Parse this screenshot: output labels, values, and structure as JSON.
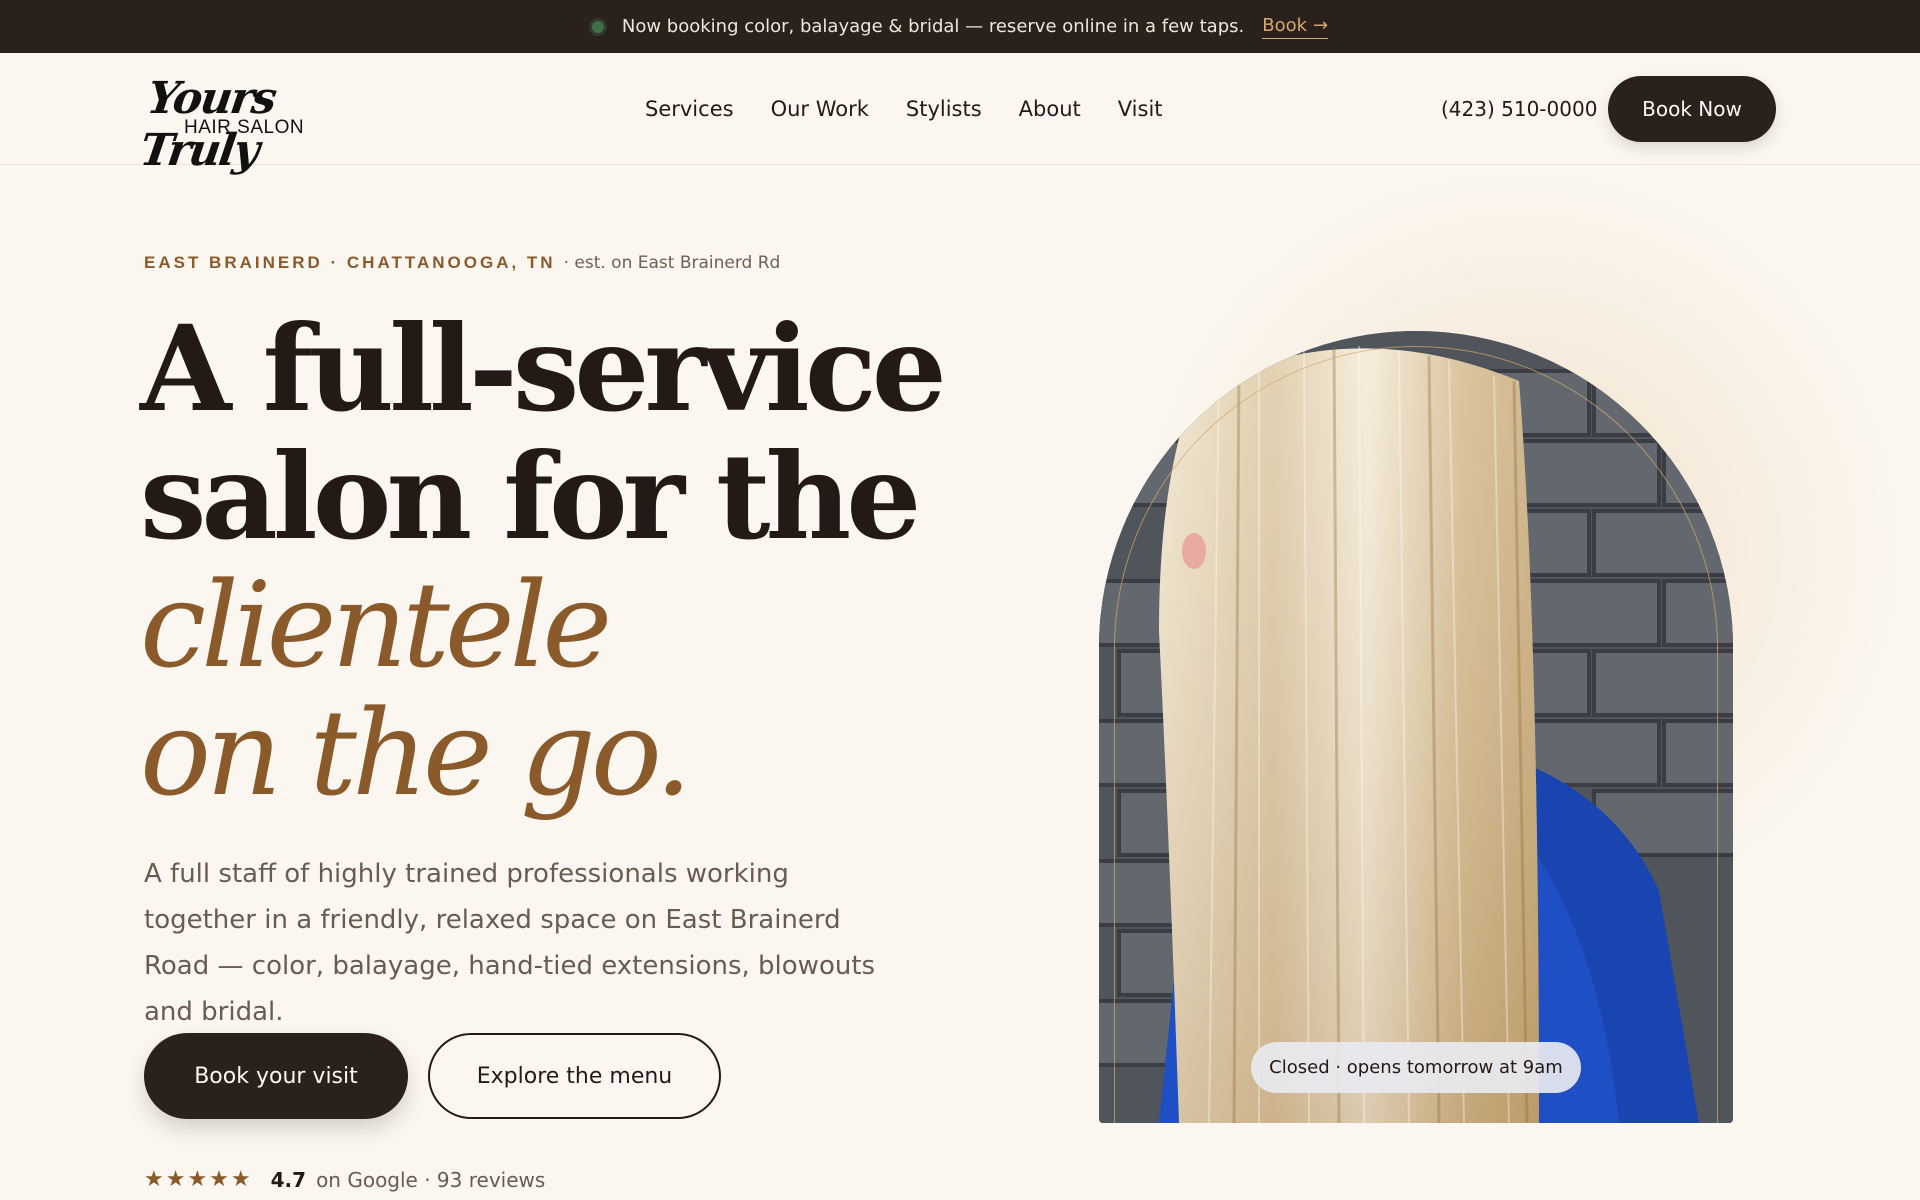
{
  "announcement": {
    "message": "Now booking color, balayage & bridal — reserve online in a few taps.",
    "link_label": "Book",
    "link_arrow": "→"
  },
  "header": {
    "logo_script": "Yours Truly",
    "logo_sub": "HAIR SALON",
    "nav": [
      "Services",
      "Our Work",
      "Stylists",
      "About",
      "Visit"
    ],
    "phone": "(423) 510-0000",
    "book_now_label": "Book Now"
  },
  "hero": {
    "eyebrow_location": "EAST BRAINERD · CHATTANOOGA, TN",
    "eyebrow_est": "· est. on East Brainerd Rd",
    "headline_lines": [
      "A full-service",
      "salon for the"
    ],
    "headline_accent_lines": [
      "clientele",
      "on the go."
    ],
    "lede": "A full staff of highly trained professionals working together in a friendly, relaxed space on East Brainerd Road — color, balayage, hand-tied extensions, blowouts and bridal.",
    "cta_primary": "Book your visit",
    "cta_secondary": "Explore the menu",
    "rating": {
      "stars": "★★★★★",
      "score": "4.7",
      "source": "on Google · 93 reviews",
      "value": 4.7
    },
    "status_pill": "Closed · opens tomorrow at 9am"
  },
  "colors": {
    "background": "#fbf7f0",
    "dark": "#2a201c",
    "accent": "#8a5a2b",
    "link_gold": "#d6a86c",
    "status_green": "#3f6f49"
  },
  "icons": {
    "status_dot": "status-dot-icon",
    "arrow": "arrow-right-icon",
    "star": "star-icon"
  }
}
